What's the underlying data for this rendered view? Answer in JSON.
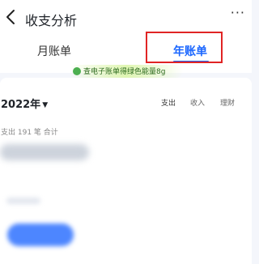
{
  "header": {
    "title": "收支分析",
    "more_label": "···"
  },
  "tabs": [
    {
      "label": "月账单"
    },
    {
      "label": "年账单"
    }
  ],
  "promo": {
    "text": "查电子账单得绿色能量8g"
  },
  "filter": {
    "year": "2022年",
    "segments": [
      {
        "label": "支出"
      },
      {
        "label": "收入"
      },
      {
        "label": "理财"
      }
    ]
  },
  "summary": {
    "text": "支出 191 笔 合计"
  },
  "colors": {
    "accent": "#1a66ff",
    "highlight": "#e02424",
    "promo_green": "#4caf50"
  }
}
